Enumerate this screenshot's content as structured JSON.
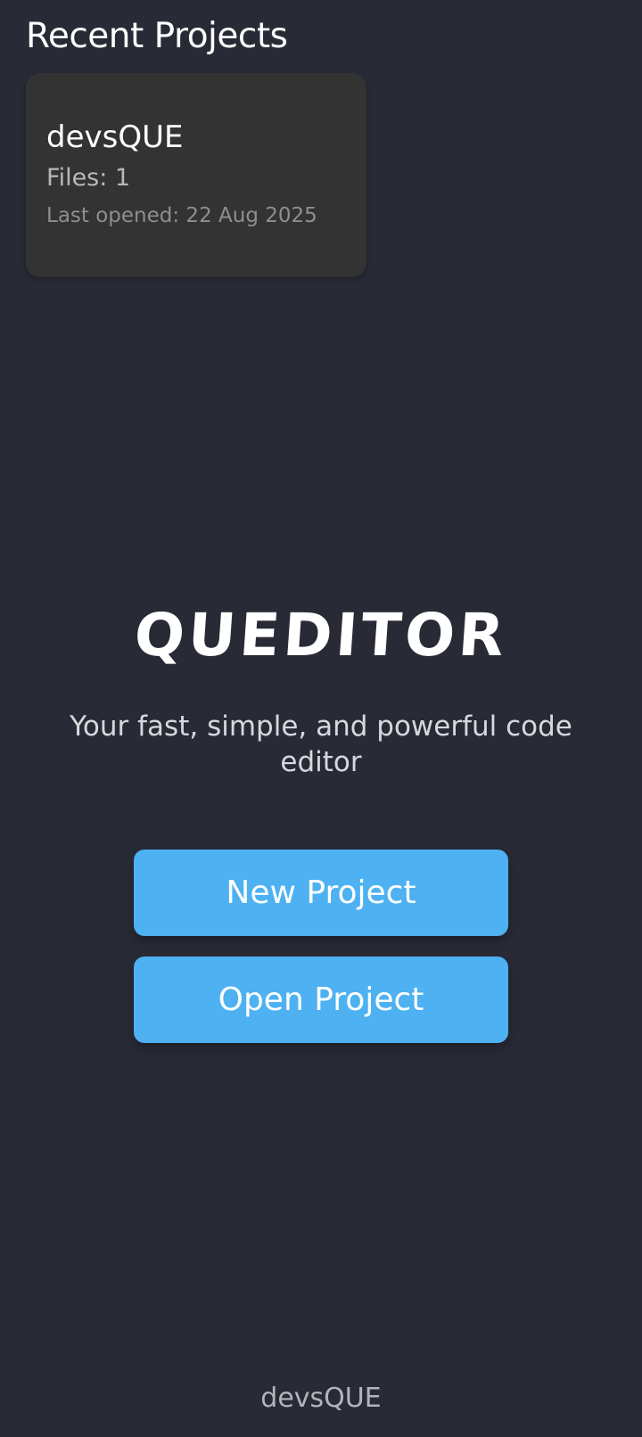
{
  "recent": {
    "title": "Recent Projects",
    "projects": [
      {
        "name": "devsQUE",
        "files": "Files: 1",
        "last_opened": "Last opened: 22 Aug 2025"
      }
    ]
  },
  "hero": {
    "logo": "QUEDITOR",
    "tagline": "Your fast, simple, and powerful code editor"
  },
  "actions": {
    "new_project": "New Project",
    "open_project": "Open Project"
  },
  "footer": {
    "text": "devsQUE"
  },
  "colors": {
    "background": "#282a36",
    "card": "#333333",
    "accent": "#4db1f2"
  }
}
